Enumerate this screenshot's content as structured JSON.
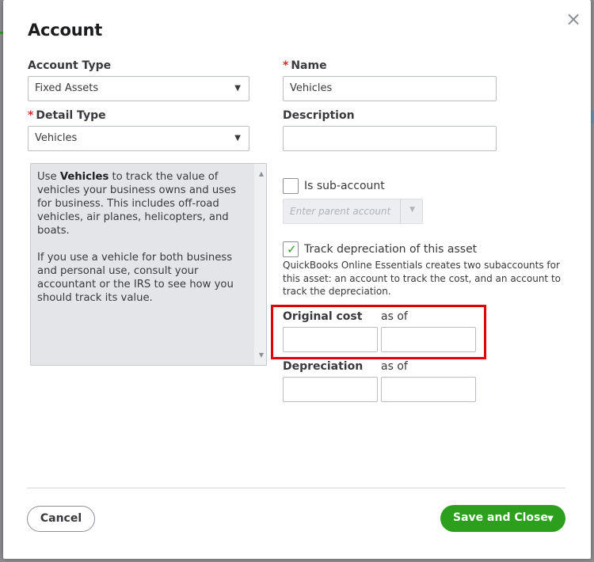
{
  "dialog": {
    "title": "Account",
    "close_glyph": "×"
  },
  "account_type": {
    "label": "Account Type",
    "value": "Fixed Assets"
  },
  "detail_type": {
    "required_mark": "*",
    "label": "Detail Type",
    "value": "Vehicles"
  },
  "name": {
    "required_mark": "*",
    "label": "Name",
    "value": "Vehicles"
  },
  "description": {
    "label": "Description",
    "value": ""
  },
  "detail_help": {
    "p1_prefix": "Use ",
    "p1_bold": "Vehicles",
    "p1_rest": " to track the value of vehicles your business owns and uses for business. This includes off-road vehicles, air planes, helicopters, and boats.",
    "p2": "If you use a vehicle for both business and personal use, consult your accountant or the IRS to see how you should track its value."
  },
  "sub_account": {
    "label": "Is sub-account",
    "checked": false,
    "parent_placeholder": "Enter parent account"
  },
  "depreciation": {
    "track_label": "Track depreciation of this asset",
    "checked": true,
    "info": "QuickBooks Online Essentials creates two subaccounts for this asset: an account to track the cost, and an account to track the depreciation.",
    "original_cost_label": "Original cost",
    "as_of_label_1": "as of",
    "depreciation_label": "Depreciation",
    "as_of_label_2": "as of",
    "original_cost_value": "",
    "original_cost_date": "",
    "depreciation_value": "",
    "depreciation_date": ""
  },
  "footer": {
    "cancel_label": "Cancel",
    "save_label": "Save and Close"
  },
  "icons": {
    "caret": "▼",
    "checkmark": "✓",
    "scroll_up": "▲",
    "scroll_down": "▼"
  },
  "colors": {
    "accent_green": "#2ca01c",
    "required_red": "#d52b1e",
    "highlight_red": "#e2000a"
  }
}
